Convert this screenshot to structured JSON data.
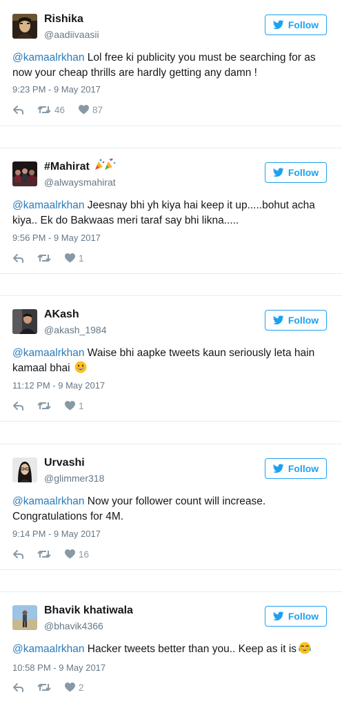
{
  "follow_label": "Follow",
  "colors": {
    "accent": "#1da1f2",
    "mention": "#2b7bb9",
    "muted": "#657786",
    "action": "#8899a6",
    "divider": "#e6ecf0"
  },
  "icons": {
    "reply": "reply-arrow-icon",
    "retweet": "retweet-icon",
    "like": "heart-icon",
    "follow": "twitter-bird-icon"
  },
  "tweets": [
    {
      "name": "Rishika",
      "handle": "@aadiivaasii",
      "mention": "@kamaalrkhan",
      "text": " Lol free ki publicity you must be searching for as now your cheap thrills are hardly getting any damn !",
      "time": "9:23 PM - 9 May 2017",
      "retweets": "46",
      "likes": "87"
    },
    {
      "name": "#Mahirat",
      "name_emoji": "party-popper-icons",
      "handle": "@alwaysmahirat",
      "mention": "@kamaalrkhan",
      "text": " Jeesnay bhi yh kiya hai keep it up.....bohut acha kiya.. Ek do Bakwaas meri taraf say bhi likna.....",
      "time": "9:56 PM - 9 May 2017",
      "retweets": "",
      "likes": "1"
    },
    {
      "name": "AKash",
      "handle": "@akash_1984",
      "mention": "@kamaalrkhan",
      "text": " Waise bhi aapke tweets kaun seriously leta hain kamaal bhai ",
      "text_emoji": "grinning-face-emoji",
      "time": "11:12 PM - 9 May 2017",
      "retweets": "",
      "likes": "1"
    },
    {
      "name": "Urvashi",
      "handle": "@glimmer318",
      "mention": "@kamaalrkhan",
      "text": " Now your follower count will increase. Congratulations for 4M.",
      "time": "9:14 PM - 9 May 2017",
      "retweets": "",
      "likes": "16"
    },
    {
      "name": "Bhavik khatiwala",
      "handle": "@bhavik4366",
      "mention": "@kamaalrkhan",
      "text": " Hacker tweets better than you.. Keep as it is",
      "text_emoji": "tears-of-joy-emoji",
      "time": "10:58 PM - 9 May 2017",
      "retweets": "",
      "likes": "2"
    }
  ]
}
